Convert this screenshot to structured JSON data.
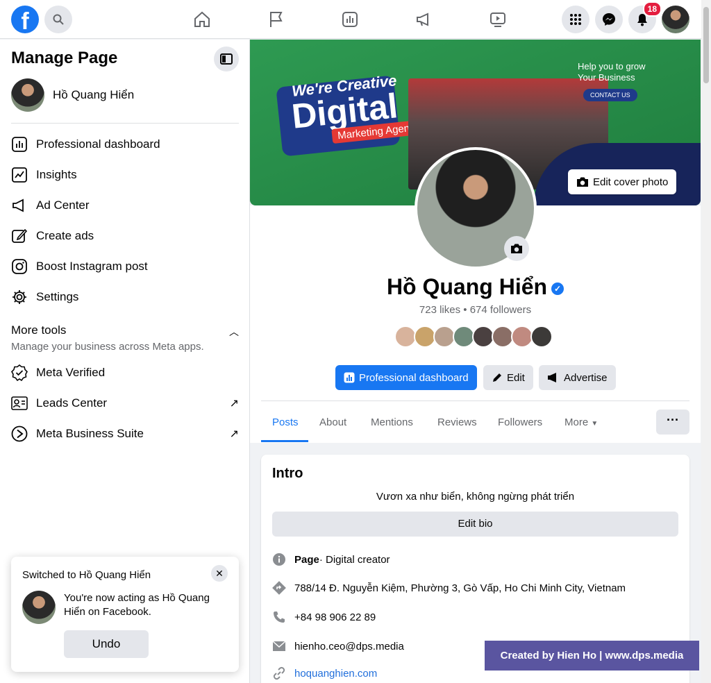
{
  "sidebar": {
    "title": "Manage Page",
    "profile_name": "Hồ Quang Hiển",
    "items": [
      {
        "label": "Professional dashboard"
      },
      {
        "label": "Insights"
      },
      {
        "label": "Ad Center"
      },
      {
        "label": "Create ads"
      },
      {
        "label": "Boost Instagram post"
      },
      {
        "label": "Settings"
      }
    ],
    "more_tools": {
      "title": "More tools",
      "subtitle": "Manage your business across Meta apps.",
      "items": [
        {
          "label": "Meta Verified"
        },
        {
          "label": "Leads Center",
          "external": "↗"
        },
        {
          "label": "Meta Business Suite",
          "external": "↗"
        }
      ]
    }
  },
  "topbar": {
    "notification_count": "18"
  },
  "toast": {
    "title": "Switched to Hồ Quang Hiển",
    "message": "You're now acting as Hồ Quang Hiển on Facebook.",
    "undo_label": "Undo"
  },
  "cover": {
    "creative": "We're Creative",
    "digital": "Digital",
    "agency": "Marketing Agency",
    "help": "Help you to grow Your Business",
    "contact": "CONTACT US",
    "edit_label": "Edit cover photo"
  },
  "page": {
    "name": "Hồ Quang Hiển",
    "stats": "723 likes • 674 followers",
    "buttons": {
      "dashboard": "Professional dashboard",
      "edit": "Edit",
      "advertise": "Advertise"
    },
    "tabs": [
      "Posts",
      "About",
      "Mentions",
      "Reviews",
      "Followers",
      "More"
    ],
    "more_dots": "···"
  },
  "intro": {
    "title": "Intro",
    "bio": "Vươn xa như biển, không ngừng phát triển",
    "edit_bio": "Edit bio",
    "category_label": "Page",
    "category_value": " · Digital creator",
    "address": "788/14 Đ. Nguyễn Kiệm, Phường 3, Gò Vấp, Ho Chi Minh City, Vietnam",
    "phone": "+84 98 906 22 89",
    "email": "hienho.ceo@dps.media",
    "website": "hoquanghien.com"
  },
  "watermark": "Created by Hien Ho | www.dps.media",
  "colors": {
    "brand": "#1877f2",
    "badge": "#e41e3f",
    "watermark_bg": "#5a55a0"
  }
}
